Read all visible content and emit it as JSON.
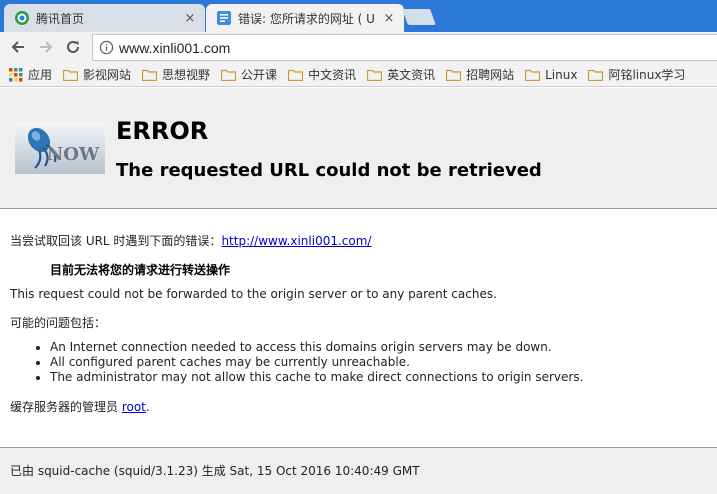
{
  "tabs": [
    {
      "title": "腾讯首页",
      "icon": "tencent-icon",
      "close": "×"
    },
    {
      "title": "错误: 您所请求的网址 ( U",
      "icon": "document-icon",
      "close": "×"
    }
  ],
  "toolbar": {
    "url": "www.xinli001.com"
  },
  "bookmarks": {
    "apps_label": "应用",
    "items": [
      "影视网站",
      "思想视野",
      "公开课",
      "中文资讯",
      "英文资讯",
      "招聘网站",
      "Linux",
      "阿铭linux学习"
    ]
  },
  "page": {
    "logo_text": "NOW",
    "error_title": "ERROR",
    "error_subtitle": "The requested URL could not be retrieved",
    "retrieve_prefix": "当尝试取回该 URL 时遇到下面的错误：",
    "retrieve_url": "http://www.xinli001.com/",
    "cannot_forward": "目前无法将您的请求进行转送操作",
    "forward_detail": "This request could not be forwarded to the origin server or to any parent caches.",
    "possible_causes": "可能的问题包括：",
    "causes": [
      "An Internet connection needed to access this domains origin servers may be down.",
      "All configured parent caches may be currently unreachable.",
      "The administrator may not allow this cache to make direct connections to origin servers."
    ],
    "admin_prefix": "缓存服务器的管理员 ",
    "admin_link": "root",
    "admin_suffix": ".",
    "footer": "已由 squid-cache (squid/3.1.23) 生成 Sat, 15 Oct 2016 10:40:49 GMT"
  },
  "colors": {
    "tabstrip": "#2c78d9",
    "link": "#0000cc",
    "folder": "#e0b64c"
  }
}
